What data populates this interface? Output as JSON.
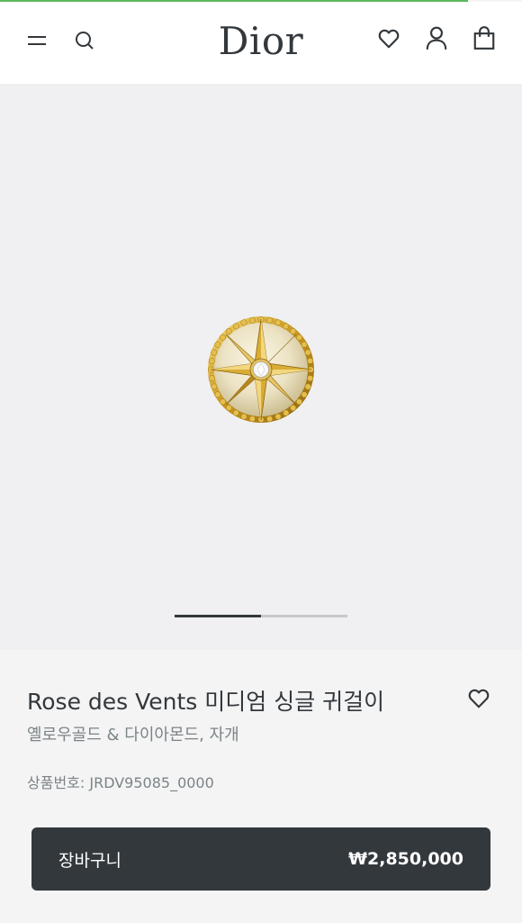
{
  "header": {
    "logo": "Dior",
    "icons": [
      "menu-icon",
      "search-icon",
      "heart-icon",
      "account-icon",
      "bag-icon"
    ]
  },
  "gallery": {
    "current_slide": 1,
    "total_slides": 2
  },
  "product": {
    "title": "Rose des Vents 미디엄 싱글 귀걸이",
    "subtitle": "옐로우골드 & 다이아몬드, 자개",
    "sku": "상품번호: JRDV95085_0000"
  },
  "cart_button": {
    "label": "장바구니",
    "price": "₩2,850,000"
  },
  "colors": {
    "dark": "#33383c",
    "muted": "#7b8487",
    "gold": "#d4a72c",
    "progress": "#5cb85c"
  }
}
